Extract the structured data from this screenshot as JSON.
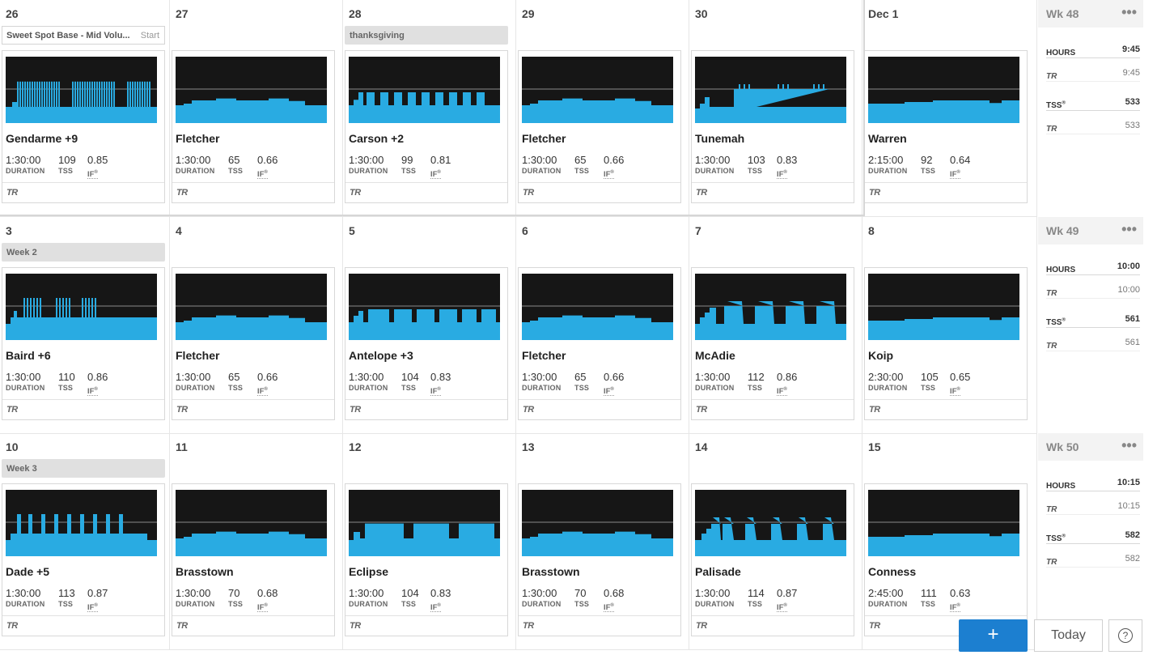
{
  "colors": {
    "workout_fill": "#29abe2",
    "graph_bg": "#161616",
    "ftp_line": "#8a8a8a",
    "accent": "#1c7fd0"
  },
  "weeks": [
    {
      "summary": {
        "label": "Wk 48",
        "more": "•••",
        "hours_label": "HOURS",
        "hours": "9:45",
        "tr_label": "TR",
        "tr_hours": "9:45",
        "tss_label": "TSS",
        "tss": "533",
        "tr_tss_label": "TR",
        "tr_tss": "533"
      },
      "days": [
        {
          "date": "26",
          "plan": {
            "text": "Sweet Spot Base - Mid Volu...",
            "action": "Start"
          },
          "workout": {
            "name": "Gendarme +9",
            "duration": "1:30:00",
            "tss": "109",
            "if": "0.85",
            "shape": "micro_long"
          }
        },
        {
          "date": "27",
          "workout": {
            "name": "Fletcher",
            "duration": "1:30:00",
            "tss": "65",
            "if": "0.66",
            "shape": "endurance"
          }
        },
        {
          "date": "28",
          "note": "thanksgiving",
          "workout": {
            "name": "Carson +2",
            "duration": "1:30:00",
            "tss": "99",
            "if": "0.81",
            "shape": "intervals_carson"
          }
        },
        {
          "date": "29",
          "workout": {
            "name": "Fletcher",
            "duration": "1:30:00",
            "tss": "65",
            "if": "0.66",
            "shape": "endurance"
          }
        },
        {
          "date": "30",
          "workout": {
            "name": "Tunemah",
            "duration": "1:30:00",
            "tss": "103",
            "if": "0.83",
            "shape": "tunemah"
          }
        },
        {
          "date": "Dec  1",
          "workout": {
            "name": "Warren",
            "duration": "2:15:00",
            "tss": "92",
            "if": "0.64",
            "shape": "endurance_long"
          }
        }
      ]
    },
    {
      "summary": {
        "label": "Wk 49",
        "more": "•••",
        "hours_label": "HOURS",
        "hours": "10:00",
        "tr_label": "TR",
        "tr_hours": "10:00",
        "tss_label": "TSS",
        "tss": "561",
        "tr_tss_label": "TR",
        "tr_tss": "561"
      },
      "days": [
        {
          "date": "3",
          "note": "Week 2",
          "workout": {
            "name": "Baird +6",
            "duration": "1:30:00",
            "tss": "110",
            "if": "0.86",
            "shape": "micro_baird"
          }
        },
        {
          "date": "4",
          "workout": {
            "name": "Fletcher",
            "duration": "1:30:00",
            "tss": "65",
            "if": "0.66",
            "shape": "endurance"
          }
        },
        {
          "date": "5",
          "workout": {
            "name": "Antelope +3",
            "duration": "1:30:00",
            "tss": "104",
            "if": "0.83",
            "shape": "blocks"
          }
        },
        {
          "date": "6",
          "workout": {
            "name": "Fletcher",
            "duration": "1:30:00",
            "tss": "65",
            "if": "0.66",
            "shape": "endurance"
          }
        },
        {
          "date": "7",
          "workout": {
            "name": "McAdie",
            "duration": "1:30:00",
            "tss": "112",
            "if": "0.86",
            "shape": "mcadie"
          }
        },
        {
          "date": "8",
          "workout": {
            "name": "Koip",
            "duration": "2:30:00",
            "tss": "105",
            "if": "0.65",
            "shape": "endurance_long"
          }
        }
      ]
    },
    {
      "summary": {
        "label": "Wk 50",
        "more": "•••",
        "hours_label": "HOURS",
        "hours": "10:15",
        "tr_label": "TR",
        "tr_hours": "10:15",
        "tss_label": "TSS",
        "tss": "582",
        "tr_tss_label": "TR",
        "tr_tss": "582"
      },
      "days": [
        {
          "date": "10",
          "note": "Week 3",
          "workout": {
            "name": "Dade +5",
            "duration": "1:30:00",
            "tss": "113",
            "if": "0.87",
            "shape": "dade"
          }
        },
        {
          "date": "11",
          "workout": {
            "name": "Brasstown",
            "duration": "1:30:00",
            "tss": "70",
            "if": "0.68",
            "shape": "endurance"
          }
        },
        {
          "date": "12",
          "workout": {
            "name": "Eclipse",
            "duration": "1:30:00",
            "tss": "104",
            "if": "0.83",
            "shape": "eclipse"
          }
        },
        {
          "date": "13",
          "workout": {
            "name": "Brasstown",
            "duration": "1:30:00",
            "tss": "70",
            "if": "0.68",
            "shape": "endurance"
          }
        },
        {
          "date": "14",
          "workout": {
            "name": "Palisade",
            "duration": "1:30:00",
            "tss": "114",
            "if": "0.87",
            "shape": "palisade"
          }
        },
        {
          "date": "15",
          "workout": {
            "name": "Conness",
            "duration": "2:45:00",
            "tss": "111",
            "if": "0.63",
            "shape": "endurance_long"
          }
        }
      ]
    }
  ],
  "labels": {
    "duration": "DURATION",
    "tss": "TSS",
    "if": "IF",
    "tr_logo": "TR"
  },
  "actions": {
    "add": "+",
    "today": "Today",
    "help": "?"
  }
}
